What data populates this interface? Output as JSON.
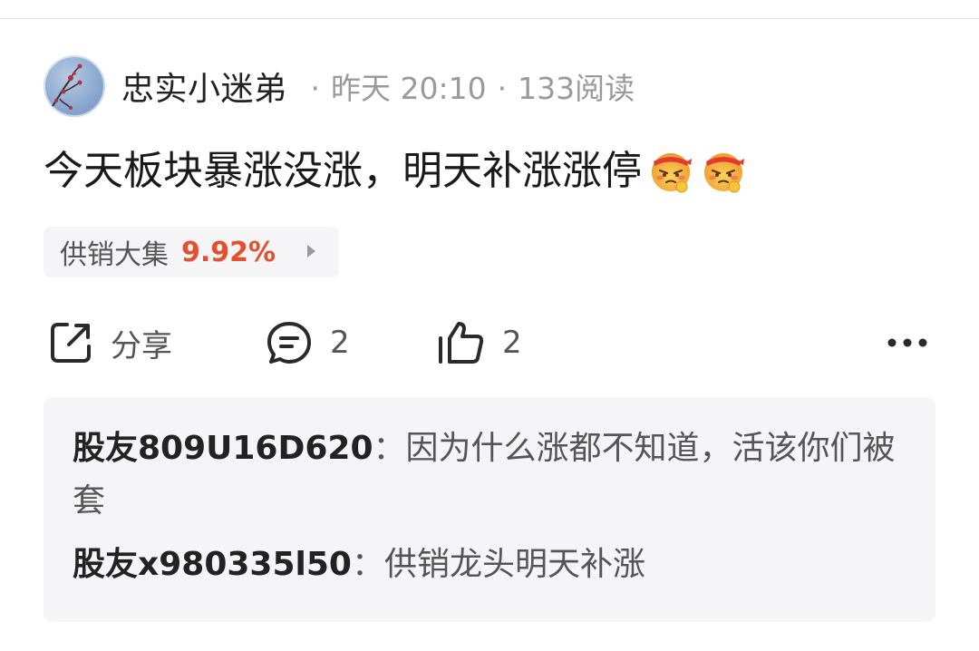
{
  "post": {
    "author": "忠实小迷弟",
    "meta": {
      "sep": "·",
      "time": "昨天 20:10",
      "reads": "133阅读"
    },
    "title": "今天板块暴涨没涨，明天补涨涨停",
    "stock_tag": {
      "name": "供销大集",
      "change": "9.92%"
    },
    "actions": {
      "share_label": "分享",
      "comment_count": "2",
      "like_count": "2"
    },
    "comments": [
      {
        "author": "股友809U16D620",
        "colon": "：",
        "text": "因为什么涨都不知道，活该你们被套"
      },
      {
        "author": "股友x980335l50",
        "colon": "：",
        "text": "供销龙头明天补涨"
      }
    ]
  },
  "colors": {
    "stock_up": "#e2502d",
    "muted_text": "#9a9a9a",
    "panel_bg": "#f5f5f7"
  },
  "icons": {
    "share": "share-icon",
    "comment": "comment-icon",
    "like": "thumbs-up-icon",
    "more": "more-dots-icon",
    "emoji": "determined-face-emoji"
  }
}
